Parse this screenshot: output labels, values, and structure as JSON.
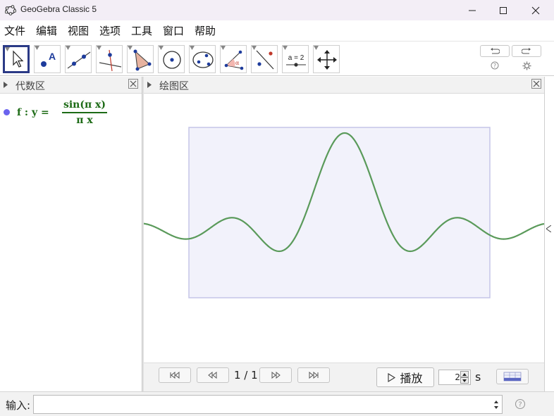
{
  "window": {
    "title": "GeoGebra Classic 5",
    "icon": "geogebra-logo-icon",
    "controls": [
      "minimize-icon",
      "maximize-icon",
      "close-icon"
    ]
  },
  "menu": [
    "文件",
    "编辑",
    "视图",
    "选项",
    "工具",
    "窗口",
    "帮助"
  ],
  "toolbar": {
    "tools": [
      {
        "name": "move-tool",
        "icon": "pointer-arrow-icon",
        "selected": true
      },
      {
        "name": "point-tool",
        "icon": "point-a-icon",
        "text": "A"
      },
      {
        "name": "line-tool",
        "icon": "line-through-two-points-icon"
      },
      {
        "name": "perpendicular-line-tool",
        "icon": "perpendicular-line-icon"
      },
      {
        "name": "polygon-tool",
        "icon": "polygon-icon"
      },
      {
        "name": "circle-tool",
        "icon": "circle-center-point-icon"
      },
      {
        "name": "ellipse-tool",
        "icon": "ellipse-icon"
      },
      {
        "name": "angle-tool",
        "icon": "angle-icon",
        "text": "α"
      },
      {
        "name": "reflect-tool",
        "icon": "reflect-about-line-icon"
      },
      {
        "name": "slider-tool",
        "icon": "slider-icon",
        "text": "a = 2"
      },
      {
        "name": "move-graphics-view-tool",
        "icon": "move-cross-arrows-icon"
      }
    ],
    "right_icons": [
      "undo-icon",
      "redo-icon",
      "help-icon",
      "settings-gear-icon"
    ]
  },
  "algebra_view": {
    "title": "代数区",
    "objects": [
      {
        "name": "f",
        "lhs": "f : y =",
        "numerator": "sin(π x)",
        "denominator": "π x",
        "color": "#1d6b16",
        "dot_color": "#6a63ee"
      }
    ]
  },
  "graphics_view": {
    "title": "绘图区",
    "export_frame_color": "#c5c5e8",
    "export_frame_fill": "#f2f2fb",
    "curve_color": "#5a9a5a",
    "function": "sin(π x) / (π x)"
  },
  "animation_bar": {
    "page_text": "1 / 1",
    "play_label": "播放",
    "speed_value": "2",
    "speed_unit": "s",
    "buttons": [
      "first-page-icon",
      "previous-page-icon",
      "next-page-icon",
      "last-page-icon"
    ]
  },
  "input_bar": {
    "label": "输入:",
    "value": ""
  }
}
